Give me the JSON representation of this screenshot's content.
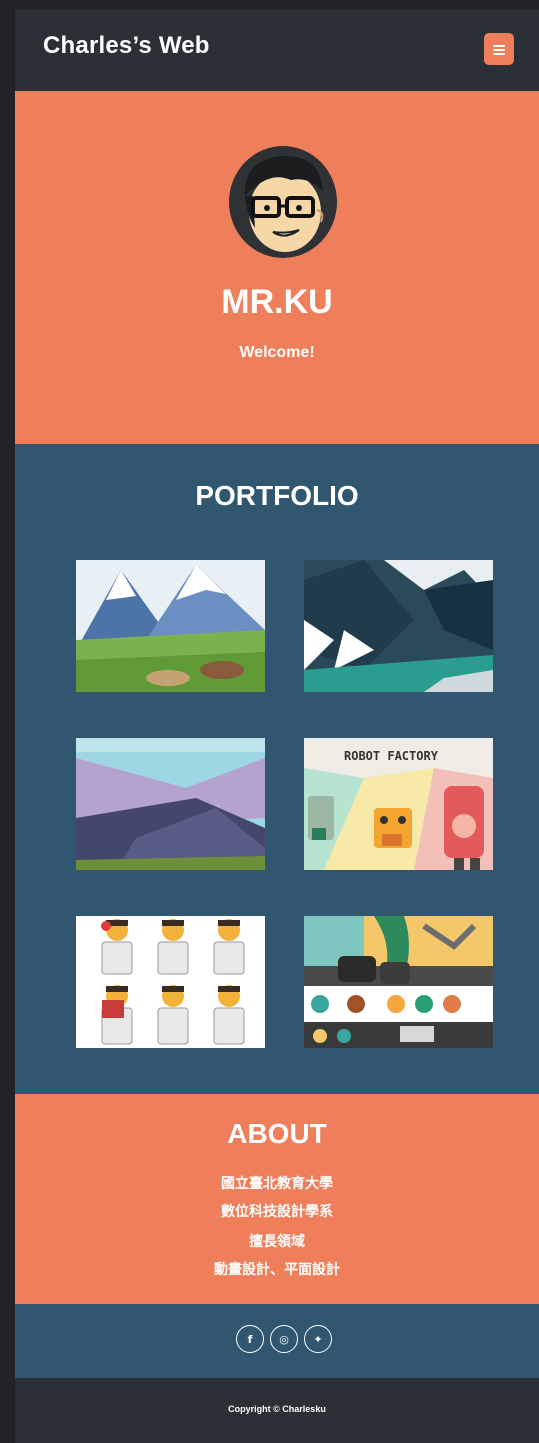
{
  "navbar": {
    "brand": "Charles’s Web",
    "menu_icon": "hamburger-icon",
    "accent": "#ef7f5b"
  },
  "hero": {
    "title": "MR.KU",
    "subtitle": "Welcome!",
    "avatar_icon": "cartoon-avatar"
  },
  "portfolio": {
    "title": "PORTFOLIO",
    "items": [
      {
        "art": "mountain-landscape-illustration"
      },
      {
        "art": "dark-mountain-river-illustration"
      },
      {
        "art": "purple-hills-illustration"
      },
      {
        "art": "robot-factory-illustration",
        "caption": "ROBOT FACTORY"
      },
      {
        "art": "character-expressions-illustration"
      },
      {
        "art": "game-machine-illustration"
      }
    ]
  },
  "about": {
    "title": "ABOUT",
    "lines": [
      "國立臺北教育大學",
      "數位科技設計學系",
      "擅長領域",
      "動畫設計、平面設計"
    ]
  },
  "social": {
    "icons": [
      "facebook-icon",
      "instagram-icon",
      "twitter-icon"
    ],
    "glyphs": {
      "facebook": "f",
      "instagram": "◎",
      "twitter": "✦"
    }
  },
  "footer": {
    "copyright": "Copyright © Charlesku"
  },
  "colors": {
    "coral": "#ef7f5b",
    "navy": "#31566f",
    "dark": "#2b3036"
  }
}
